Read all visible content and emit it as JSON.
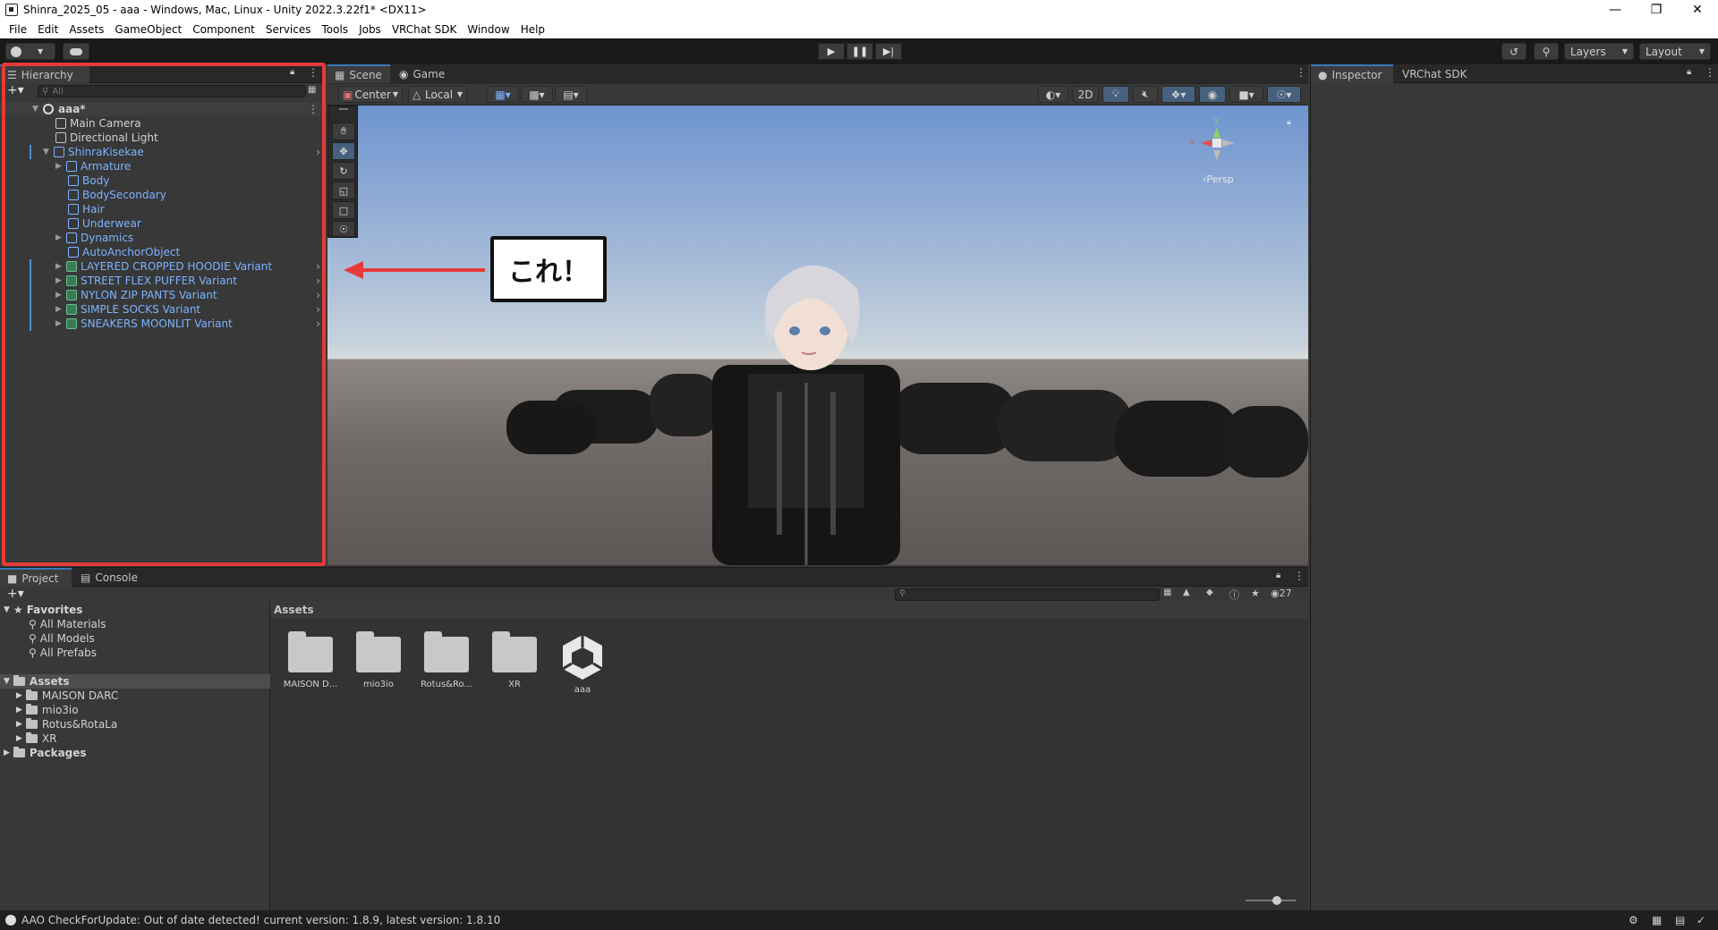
{
  "window": {
    "title": "Shinra_2025_05 - aaa - Windows, Mac, Linux - Unity 2022.3.22f1* <DX11>"
  },
  "menu": [
    "File",
    "Edit",
    "Assets",
    "GameObject",
    "Component",
    "Services",
    "Tools",
    "Jobs",
    "VRChat SDK",
    "Window",
    "Help"
  ],
  "toolbar": {
    "layers_label": "Layers",
    "layout_label": "Layout"
  },
  "hierarchy": {
    "tab_label": "Hierarchy",
    "search_placeholder": "All",
    "scene_name": "aaa*",
    "items": [
      {
        "label": "Main Camera"
      },
      {
        "label": "Directional Light"
      },
      {
        "label": "ShinraKisekae"
      },
      {
        "label": "Armature"
      },
      {
        "label": "Body"
      },
      {
        "label": "BodySecondary"
      },
      {
        "label": "Hair"
      },
      {
        "label": "Underwear"
      },
      {
        "label": "Dynamics"
      },
      {
        "label": "AutoAnchorObject"
      },
      {
        "label": "LAYERED CROPPED HOODIE Variant"
      },
      {
        "label": "STREET FLEX PUFFER Variant"
      },
      {
        "label": "NYLON ZIP PANTS Variant"
      },
      {
        "label": "SIMPLE SOCKS Variant"
      },
      {
        "label": "SNEAKERS MOONLIT Variant"
      }
    ]
  },
  "scene": {
    "tab_scene": "Scene",
    "tab_game": "Game",
    "pivot_label": "Center",
    "space_label": "Local",
    "mode_2d": "2D",
    "gizmo_persp": "Persp",
    "gizmo_x": "x",
    "gizmo_y": "y",
    "callout": "これ！"
  },
  "inspector": {
    "tab_inspector": "Inspector",
    "tab_vrchat": "VRChat SDK"
  },
  "project": {
    "tab_project": "Project",
    "tab_console": "Console",
    "favorites_label": "Favorites",
    "favorites": [
      "All Materials",
      "All Models",
      "All Prefabs"
    ],
    "assets_label": "Assets",
    "asset_folders": [
      "MAISON DARC",
      "mio3io",
      "Rotus&RotaLa",
      "XR"
    ],
    "packages_label": "Packages",
    "grid_header": "Assets",
    "grid_items": [
      "MAISON D...",
      "mio3io",
      "Rotus&Ro...",
      "XR",
      "aaa"
    ],
    "hidden_count": "27"
  },
  "status": {
    "message": "AAO CheckForUpdate: Out of date detected! current version: 1.8.9, latest version: 1.8.10"
  },
  "colors": {
    "accent_blue": "#3a79bb",
    "prefab_blue": "#7cb3ff",
    "highlight_red": "#e53a3a"
  }
}
